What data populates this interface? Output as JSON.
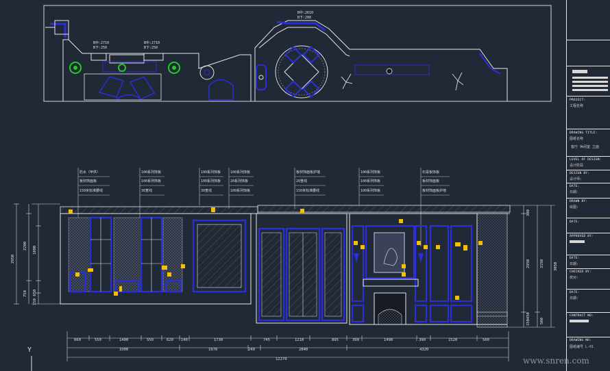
{
  "plan": {
    "tag_center_top": [
      "B中:2610",
      "B下:200"
    ],
    "tag_left": [
      "B中:2710",
      "B下:250"
    ],
    "tag_mid": [
      "B中:2710",
      "B下:250"
    ]
  },
  "elevation": {
    "notes": [
      [
        "防水（甲供）",
        "板材饰面板",
        "150米标准腰线"
      ],
      [
        "100系列饰板",
        "100系列饰板",
        "30宽线"
      ],
      [
        "100系列饰板",
        "100系列饰板",
        "30宽线"
      ],
      [
        "100系列饰板",
        "20系列饰板",
        "100系列饰板"
      ],
      [
        "板材饰面板护墙",
        "20宽线",
        "150米标准腰线"
      ],
      [
        "100系列饰板",
        "100系列饰板",
        "100系列饰板"
      ],
      [
        "石膏板饰板",
        "板材饰面板",
        "板材饰面板护墙"
      ]
    ],
    "dims_left": [
      "2950",
      "2200",
      "1800",
      "750",
      "150 650"
    ],
    "dims_right_a": [
      "300",
      "2950",
      "150450"
    ],
    "dims_right_b": [
      "3150",
      "500"
    ],
    "dims_right_c": [
      "3050"
    ],
    "dims_bottom_1": [
      "660",
      "550",
      "1400",
      "550",
      "620",
      "140",
      "1730",
      "745",
      "1210",
      "895",
      "390",
      "1490",
      "390",
      "1520",
      "500"
    ],
    "dims_bottom_2": [
      "3300",
      "1970",
      "240",
      "2840",
      "4320"
    ],
    "dims_total": "12270"
  },
  "title_block": {
    "project_label": "PROJECT:",
    "project_value": "工程名称",
    "drawing_title_label": "DRAWING TITLE:",
    "drawing_title_value": "图纸名称",
    "drawing_title_sub": "客厅 休闲室 立面",
    "level_label": "LEVEL OF DESIGN:",
    "level_value": "设计阶段",
    "design_label": "DESIGN BY:",
    "design_value": "设计师:",
    "date1_label": "DATE:",
    "date1_value": "日期:",
    "drawn_label": "DRAWN BY:",
    "drawn_value": "绘图:",
    "date2_label": "DATE:",
    "approved_label": "APPROVED BY:",
    "date3_label": "DATE:",
    "date3_value": "日期:",
    "checked_label": "CHECKED BY:",
    "checked_value": "校对:",
    "date4_label": "DATE:",
    "date4_value": "日期:",
    "contract_label": "CONTRACT NO:",
    "drawing_no_label": "DRAWING NO:",
    "drawing_no_value": "图纸编号 L-01"
  },
  "ucs_label": "Y",
  "watermark": "www.snren.com",
  "colors": {
    "bg": "#212836",
    "line": "#e8e8e8",
    "blue": "#2a2fd6",
    "yellow": "#f2c100",
    "green": "#22cc22"
  }
}
